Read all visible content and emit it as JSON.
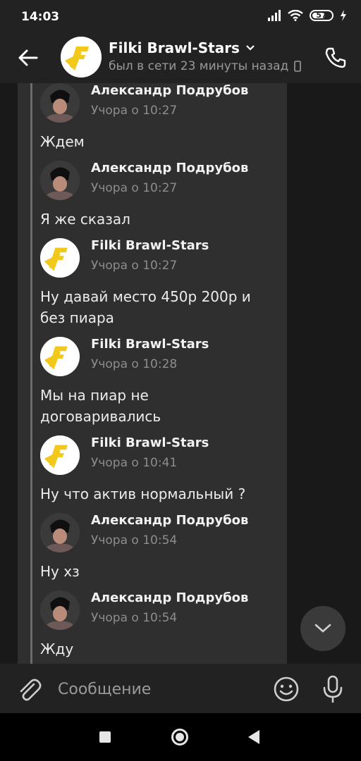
{
  "status_bar": {
    "time": "14:03",
    "battery": "57"
  },
  "header": {
    "title": "Filki Brawl-Stars",
    "subtitle": "был в сети 23 минуты назад"
  },
  "messages": [
    {
      "author": "Александр Подрубов",
      "time": "Учора о 10:27",
      "text": "Ждем",
      "avatar": "user"
    },
    {
      "author": "Александр Подрубов",
      "time": "Учора о 10:27",
      "text": "Я же сказал",
      "avatar": "user"
    },
    {
      "author": "Filki Brawl-Stars",
      "time": "Учора о 10:27",
      "text": "Ну давай место 450р 200р и без пиара",
      "avatar": "group"
    },
    {
      "author": "Filki Brawl-Stars",
      "time": "Учора о 10:28",
      "text": "Мы на пиар не договаривались",
      "avatar": "group"
    },
    {
      "author": "Filki Brawl-Stars",
      "time": "Учора о 10:41",
      "text": "Ну что актив нормальный ?",
      "avatar": "group"
    },
    {
      "author": "Александр Подрубов",
      "time": "Учора о 10:54",
      "text": "Ну хз",
      "avatar": "user"
    },
    {
      "author": "Александр Подрубов",
      "time": "Учора о 10:54",
      "text": "Жду",
      "avatar": "user"
    }
  ],
  "composer": {
    "placeholder": "Сообщение"
  },
  "colors": {
    "background": "#191919",
    "bars": "#222222",
    "bubble": "#2f2f2f",
    "logo_yellow": "#f2c81b"
  }
}
